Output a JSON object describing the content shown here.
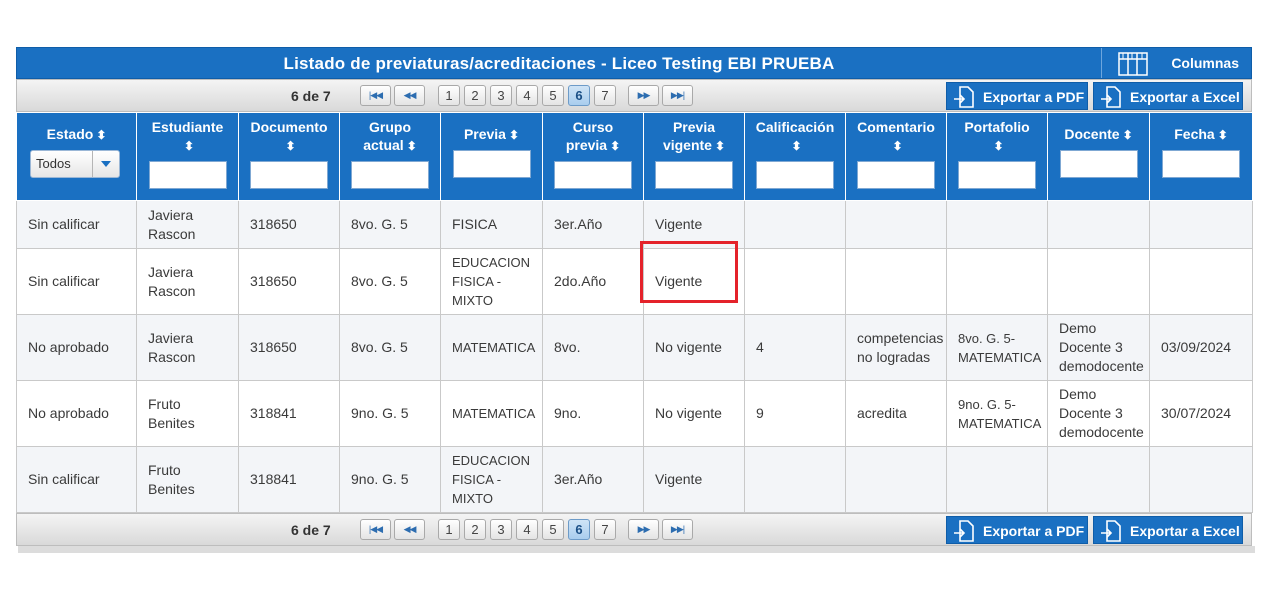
{
  "title": "Listado de previaturas/acreditaciones - Liceo Testing EBI PRUEBA",
  "columns_button": "Columnas",
  "pager": {
    "count": "6 de 7",
    "first_icon": "first-page-icon",
    "prev_icon": "prev-page-icon",
    "next_icon": "next-page-icon",
    "last_icon": "last-page-icon",
    "pages": [
      "1",
      "2",
      "3",
      "4",
      "5",
      "6",
      "7"
    ],
    "current_page": "6"
  },
  "export_pdf": "Exportar a PDF",
  "export_excel": "Exportar a Excel",
  "headers": {
    "estado": "Estado",
    "estudiante": "Estudiante",
    "documento": "Documento",
    "grupo_l1": "Grupo",
    "grupo_l2": "actual",
    "previa": "Previa",
    "curso_l1": "Curso",
    "curso_l2": "previa",
    "vigente_l1": "Previa",
    "vigente_l2": "vigente",
    "calificacion": "Calificación",
    "comentario": "Comentario",
    "portafolio": "Portafolio",
    "docente": "Docente",
    "fecha": "Fecha",
    "sort_glyph": "⬍"
  },
  "estado_filter": {
    "value": "Todos"
  },
  "rows": [
    [
      "Sin calificar",
      "Javiera Rascon",
      "318650",
      "8vo. G. 5",
      "FISICA",
      "3er.Año",
      "Vigente",
      "",
      "",
      "",
      "",
      ""
    ],
    [
      "Sin calificar",
      "Javiera Rascon",
      "318650",
      "8vo. G. 5",
      "EDUCACION FISICA - MIXTO",
      "2do.Año",
      "Vigente",
      "",
      "",
      "",
      "",
      ""
    ],
    [
      "No aprobado",
      "Javiera Rascon",
      "318650",
      "8vo. G. 5",
      "MATEMATICA",
      "8vo.",
      "No vigente",
      "4",
      "competencias no logradas",
      "8vo. G. 5-MATEMATICA",
      "Demo Docente 3 demodocente",
      "03/09/2024"
    ],
    [
      "No aprobado",
      "Fruto Benites",
      "318841",
      "9no. G. 5",
      "MATEMATICA",
      "9no.",
      "No vigente",
      "9",
      "acredita",
      "9no. G. 5-MATEMATICA",
      "Demo Docente 3 demodocente",
      "30/07/2024"
    ],
    [
      "Sin calificar",
      "Fruto Benites",
      "318841",
      "9no. G. 5",
      "EDUCACION FISICA - MIXTO",
      "3er.Año",
      "Vigente",
      "",
      "",
      "",
      "",
      ""
    ]
  ],
  "colors": {
    "header_blue": "#1a70c2",
    "highlight_red": "#e4222a"
  }
}
